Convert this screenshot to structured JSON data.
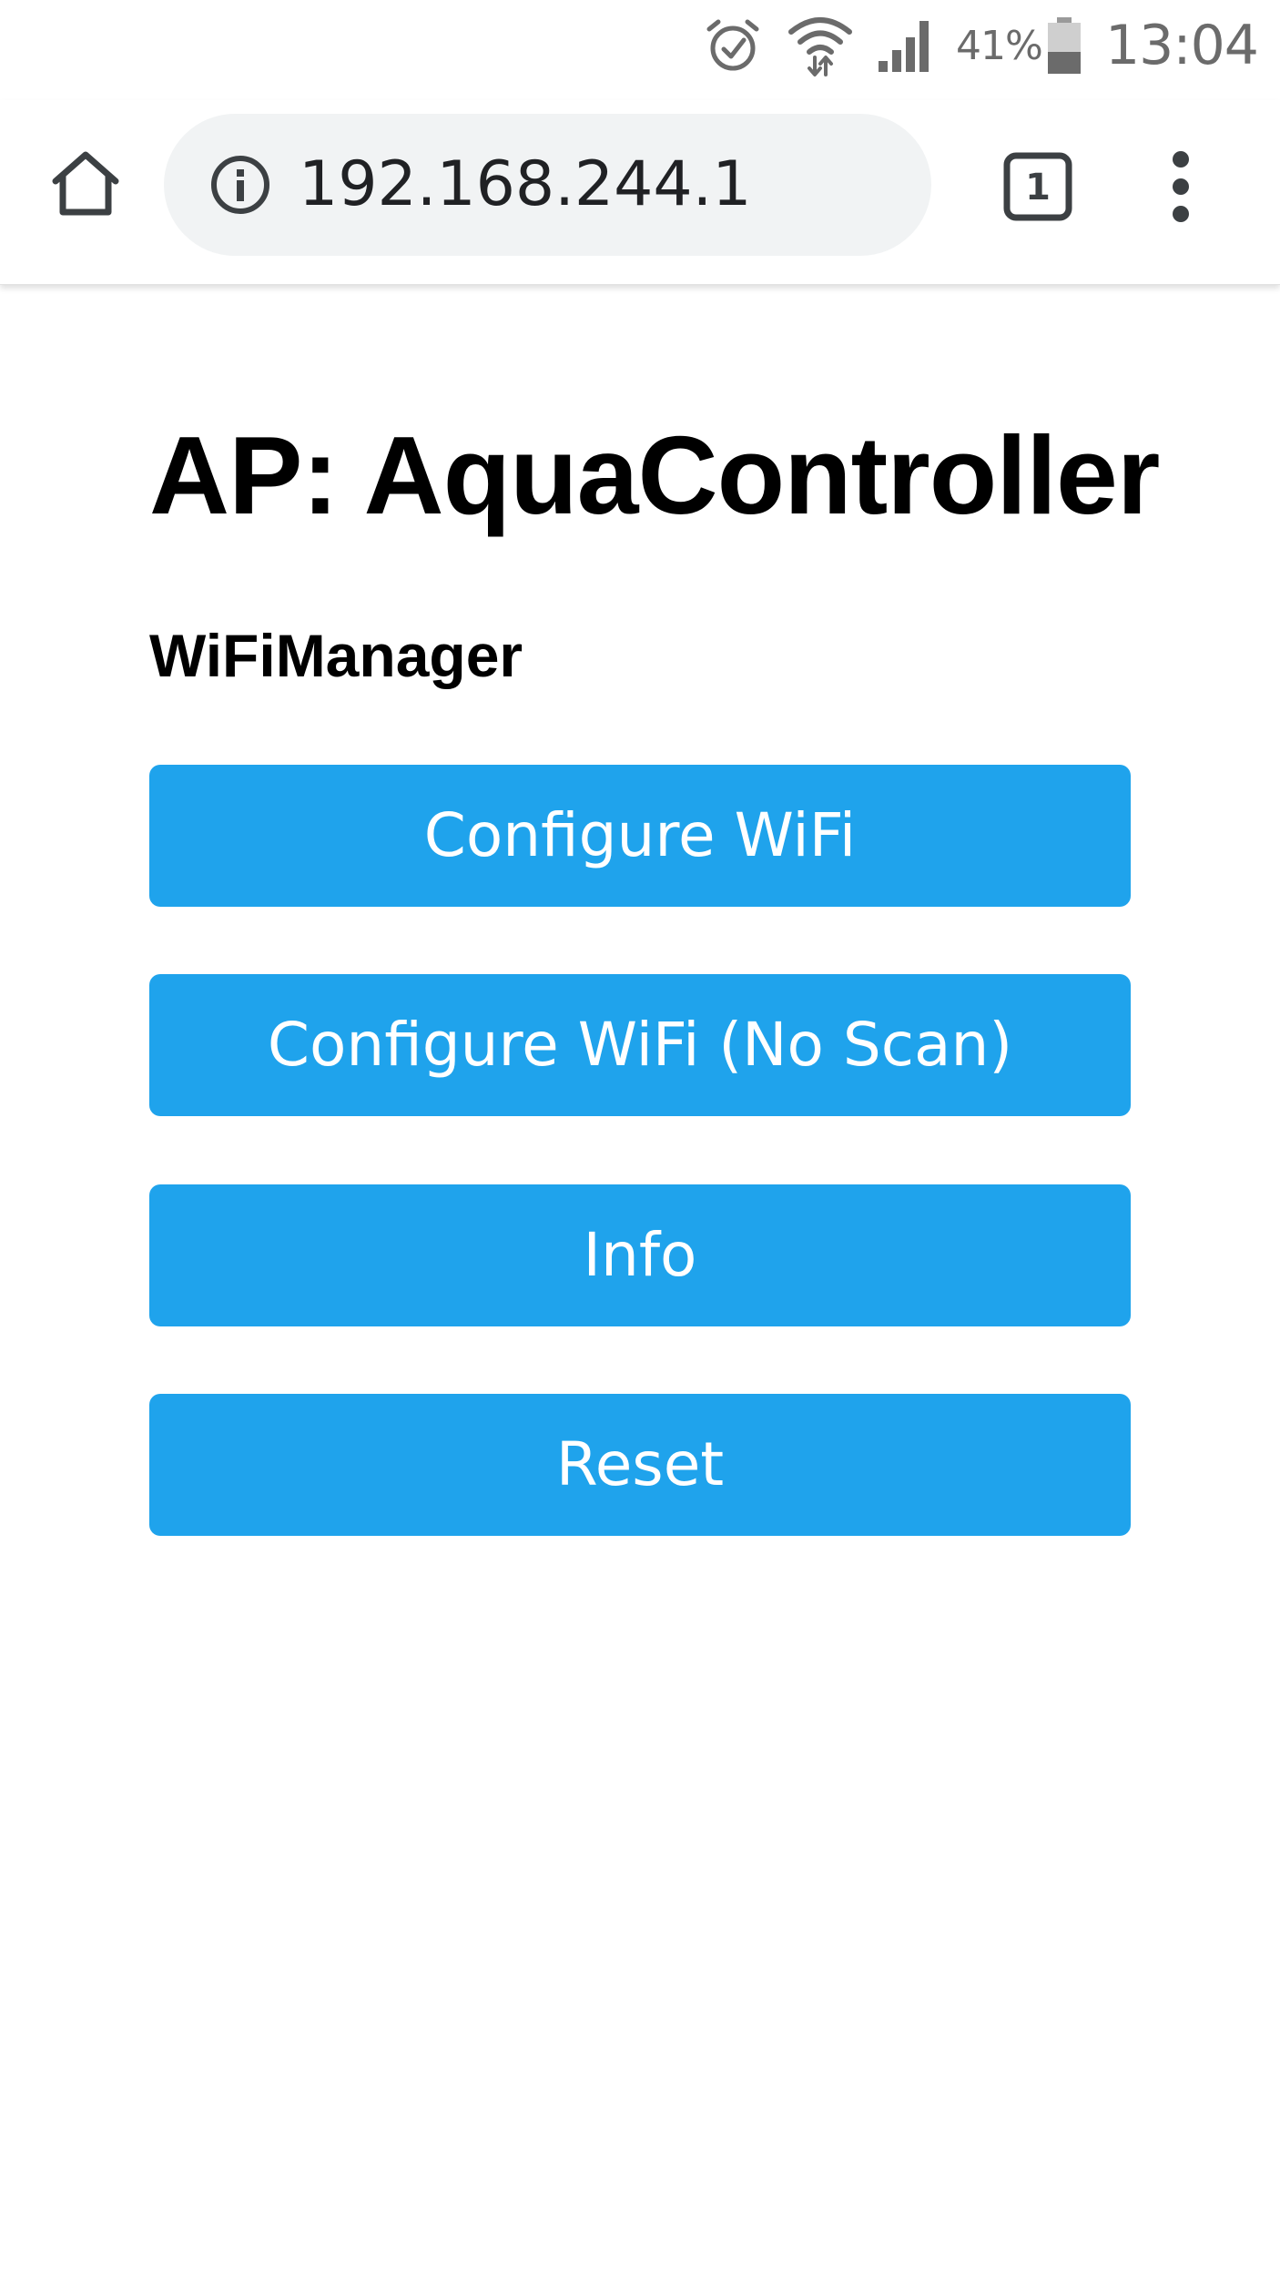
{
  "status_bar": {
    "battery_percent": "41%",
    "time": "13:04",
    "icons": [
      "alarm-icon",
      "wifi-icon",
      "cell-signal-icon",
      "battery-icon"
    ]
  },
  "browser": {
    "url": "192.168.244.1",
    "tab_count": "1",
    "icons": [
      "home-icon",
      "info-icon",
      "tabs-icon",
      "overflow-menu-icon"
    ]
  },
  "page": {
    "title": "AP: AquaController",
    "subtitle": "WiFiManager",
    "buttons": [
      {
        "label": "Configure WiFi"
      },
      {
        "label": "Configure WiFi (No Scan)"
      },
      {
        "label": "Info"
      },
      {
        "label": "Reset"
      }
    ],
    "button_color": "#1fa3ec"
  }
}
